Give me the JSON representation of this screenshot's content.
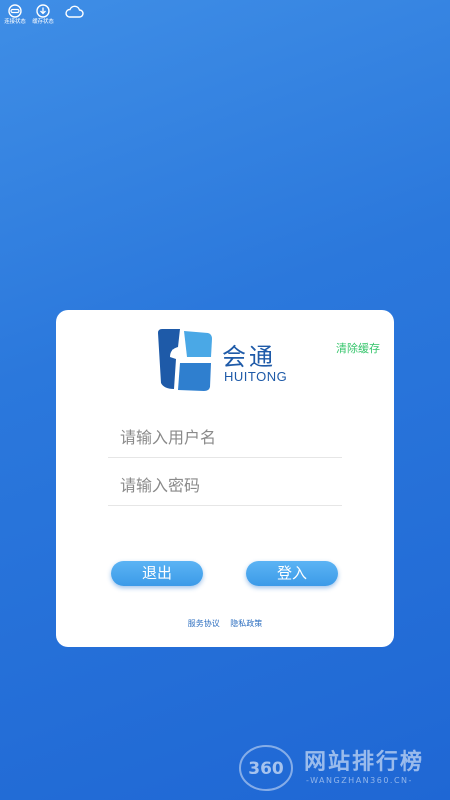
{
  "status": {
    "items": [
      {
        "icon": "link-icon",
        "label": "连接状态"
      },
      {
        "icon": "download-icon",
        "label": "缓存状态"
      },
      {
        "icon": "cloud-icon",
        "label": ""
      }
    ]
  },
  "logo": {
    "cn": "会通",
    "en": "HUITONG"
  },
  "card": {
    "clear_cache_label": "清除缓存"
  },
  "form": {
    "username_placeholder": "请输入用户名",
    "username_value": "",
    "password_placeholder": "请输入密码",
    "password_value": ""
  },
  "buttons": {
    "exit_label": "退出",
    "login_label": "登入"
  },
  "links": {
    "service_agreement": "服务协议",
    "privacy_policy": "隐私政策"
  },
  "watermark": {
    "badge": "360",
    "cn": "网站排行榜",
    "en": "-WANGZHAN360.CN-"
  },
  "colors": {
    "background_top": "#3f8ee6",
    "background_bottom": "#1f67d4",
    "logo_blue": "#1e5aa8",
    "clear_cache_green": "#35c56b",
    "button_blue": "#3b9ae8"
  }
}
